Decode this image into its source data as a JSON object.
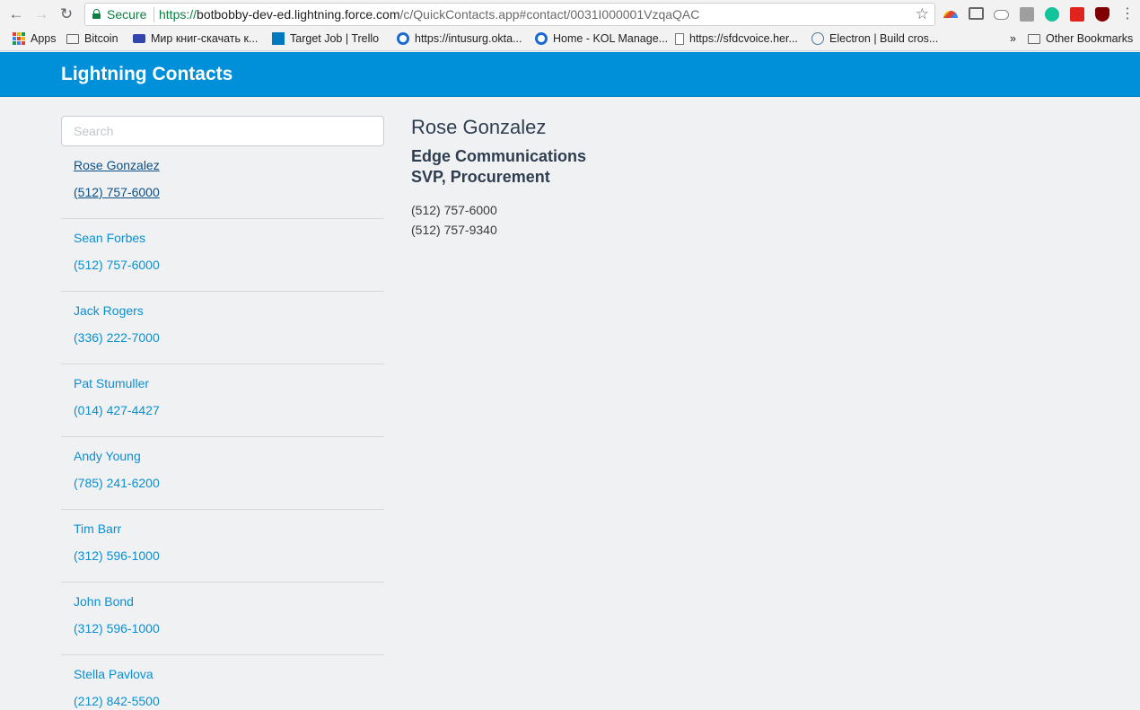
{
  "browser": {
    "secure_label": "Secure",
    "url_scheme": "https://",
    "url_host": "botbobby-dev-ed.lightning.force.com",
    "url_path": "/c/QuickContacts.app#contact/0031I000001VzqaQAC",
    "bookmarks": [
      {
        "label": "Apps",
        "icon": "apps-grid-icon"
      },
      {
        "label": "Bitcoin",
        "icon": "folder-icon"
      },
      {
        "label": "Мир книг-скачать к...",
        "icon": "site-icon"
      },
      {
        "label": "Target Job | Trello",
        "icon": "trello-icon"
      },
      {
        "label": "https://intusurg.okta...",
        "icon": "okta-icon"
      },
      {
        "label": "Home - KOL Manage...",
        "icon": "okta-icon"
      },
      {
        "label": "https://sfdcvoice.her...",
        "icon": "page-icon"
      },
      {
        "label": "Electron | Build cros...",
        "icon": "electron-icon"
      }
    ],
    "overflow_label": "»",
    "other_bookmarks": "Other Bookmarks"
  },
  "app": {
    "title": "Lightning Contacts",
    "search_placeholder": "Search"
  },
  "contacts": [
    {
      "name": "Rose Gonzalez",
      "phone": "(512) 757-6000"
    },
    {
      "name": "Sean Forbes",
      "phone": "(512) 757-6000"
    },
    {
      "name": "Jack Rogers",
      "phone": "(336) 222-7000"
    },
    {
      "name": "Pat Stumuller",
      "phone": "(014) 427-4427"
    },
    {
      "name": "Andy Young",
      "phone": "(785) 241-6200"
    },
    {
      "name": "Tim Barr",
      "phone": "(312) 596-1000"
    },
    {
      "name": "John Bond",
      "phone": "(312) 596-1000"
    },
    {
      "name": "Stella Pavlova",
      "phone": "(212) 842-5500"
    }
  ],
  "detail": {
    "name": "Rose Gonzalez",
    "company": "Edge Communications",
    "title": "SVP, Procurement",
    "phone": "(512) 757-6000",
    "mobile": "(512) 757-9340"
  },
  "colors": {
    "header": "#0090d9",
    "link": "#0c8fd0",
    "active_link": "#0a4f86",
    "background": "#f0f1f3"
  }
}
